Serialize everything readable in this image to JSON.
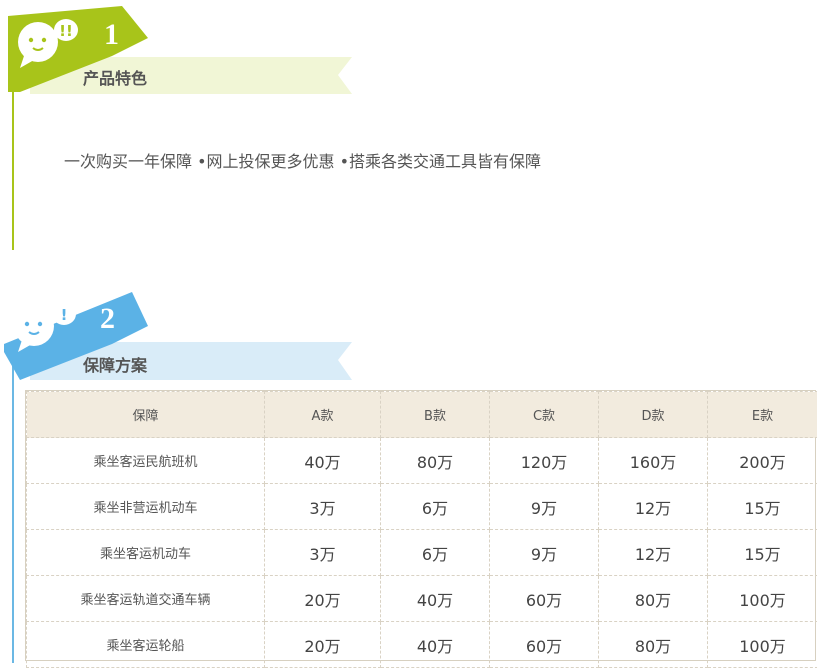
{
  "section1": {
    "number": "1",
    "title": "产品特色",
    "description": "一次购买一年保障 •网上投保更多优惠 •搭乘各类交通工具皆有保障",
    "accent_color": "#a8c41a",
    "ribbon_color": "#f1f6d6",
    "icon": "speech-bubble-exclaim-icon"
  },
  "section2": {
    "number": "2",
    "title": "保障方案",
    "accent_color": "#5bb2e6",
    "ribbon_color": "#d9ecf8",
    "icon": "speech-bubble-exclaim-icon"
  },
  "table": {
    "headers": [
      "保障",
      "A款",
      "B款",
      "C款",
      "D款",
      "E款"
    ],
    "rows": [
      [
        "乘坐客运民航班机",
        "40万",
        "80万",
        "120万",
        "160万",
        "200万"
      ],
      [
        "乘坐非营运机动车",
        "3万",
        "6万",
        "9万",
        "12万",
        "15万"
      ],
      [
        "乘坐客运机动车",
        "3万",
        "6万",
        "9万",
        "12万",
        "15万"
      ],
      [
        "乘坐客运轨道交通车辆",
        "20万",
        "40万",
        "60万",
        "80万",
        "100万"
      ],
      [
        "乘坐客运轮船",
        "20万",
        "40万",
        "60万",
        "80万",
        "100万"
      ]
    ]
  }
}
